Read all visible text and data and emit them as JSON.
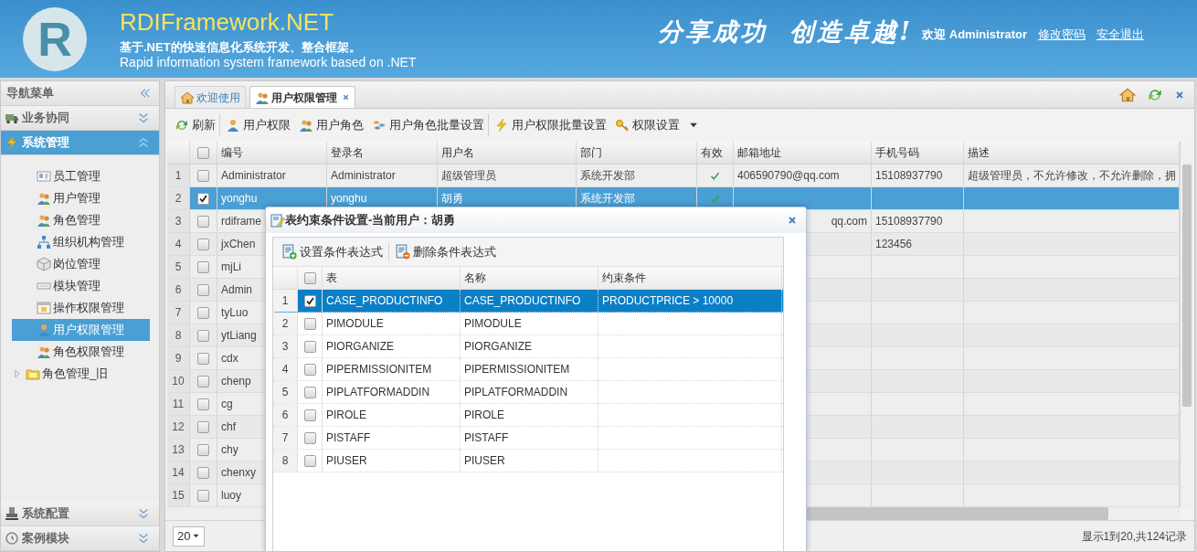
{
  "header": {
    "logo_letter": "R",
    "title": "RDIFramework.NET",
    "subtitle": "基于.NET的快速信息化系统开发、整合框架。",
    "subtitle_en": "Rapid information system framework based on .NET",
    "slogan": "分享成功  创造卓越!",
    "welcome": "欢迎 Administrator",
    "links": [
      "修改密码",
      "安全退出"
    ]
  },
  "sidebar": {
    "title": "导航菜单",
    "sections": [
      {
        "label": "业务协同",
        "expanded": false
      },
      {
        "label": "系统管理",
        "expanded": true,
        "items": [
          {
            "label": "员工管理",
            "kind": "leaf",
            "selected": false
          },
          {
            "label": "用户管理",
            "kind": "leaf",
            "selected": false
          },
          {
            "label": "角色管理",
            "kind": "leaf",
            "selected": false
          },
          {
            "label": "组织机构管理",
            "kind": "leaf",
            "selected": false
          },
          {
            "label": "岗位管理",
            "kind": "leaf",
            "selected": false
          },
          {
            "label": "模块管理",
            "kind": "leaf",
            "selected": false
          },
          {
            "label": "操作权限管理",
            "kind": "leaf",
            "selected": false
          },
          {
            "label": "用户权限管理",
            "kind": "leaf",
            "selected": true
          },
          {
            "label": "角色权限管理",
            "kind": "leaf",
            "selected": false
          },
          {
            "label": "角色管理_旧",
            "kind": "folder",
            "selected": false
          }
        ]
      },
      {
        "label": "系统配置",
        "expanded": false
      },
      {
        "label": "案例模块",
        "expanded": false
      }
    ]
  },
  "tabs": [
    {
      "label": "欢迎使用",
      "selected": false,
      "closable": false
    },
    {
      "label": "用户权限管理",
      "selected": true,
      "closable": true
    }
  ],
  "toolbar": [
    {
      "label": "刷新",
      "separator_after": true,
      "dropdown": false
    },
    {
      "label": "用户权限",
      "separator_after": false,
      "dropdown": false
    },
    {
      "label": "用户角色",
      "separator_after": false,
      "dropdown": false
    },
    {
      "label": "用户角色批量设置",
      "separator_after": true,
      "dropdown": false
    },
    {
      "label": "用户权限批量设置",
      "separator_after": false,
      "dropdown": false
    },
    {
      "label": "权限设置",
      "separator_after": false,
      "dropdown": true
    }
  ],
  "grid": {
    "header_checked": false,
    "columns": [
      "编号",
      "登录名",
      "用户名",
      "部门",
      "有效",
      "邮箱地址",
      "手机号码",
      "描述"
    ],
    "rows": [
      {
        "no": "1",
        "selected": false,
        "code": "Administrator",
        "login": "Administrator",
        "username": "超级管理员",
        "dept": "系统开发部",
        "valid": true,
        "email": "406590790@qq.com",
        "phone": "15108937790",
        "description": "超级管理员，不允许修改，不允许删除，拥"
      },
      {
        "no": "2",
        "selected": true,
        "code": "yonghu",
        "login": "yonghu",
        "username": "胡勇",
        "dept": "系统开发部",
        "valid": true
      },
      {
        "no": "3",
        "selected": false,
        "code": "rdiframe",
        "email": "qq.com",
        "phone": "15108937790"
      },
      {
        "no": "4",
        "selected": false,
        "code": "jxChen",
        "phone": "123456"
      },
      {
        "no": "5",
        "selected": false,
        "code": "mjLi"
      },
      {
        "no": "6",
        "selected": false,
        "code": "Admin"
      },
      {
        "no": "7",
        "selected": false,
        "code": "tyLuo"
      },
      {
        "no": "8",
        "selected": false,
        "code": "ytLiang"
      },
      {
        "no": "9",
        "selected": false,
        "code": "cdx"
      },
      {
        "no": "10",
        "selected": false,
        "code": "chenp"
      },
      {
        "no": "11",
        "selected": false,
        "code": "cg"
      },
      {
        "no": "12",
        "selected": false,
        "code": "chf"
      },
      {
        "no": "13",
        "selected": false,
        "code": "chy"
      },
      {
        "no": "14",
        "selected": false,
        "code": "chenxy"
      },
      {
        "no": "15",
        "selected": false,
        "code": "luoy"
      }
    ]
  },
  "pager": {
    "page_size": "20",
    "summary": "显示1到20,共124记录"
  },
  "dialog": {
    "title": "表约束条件设置-当前用户：胡勇",
    "toolbar": [
      "设置条件表达式",
      "删除条件表达式"
    ],
    "header_checked": false,
    "columns": [
      "表",
      "名称",
      "约束条件"
    ],
    "rows": [
      {
        "no": "1",
        "selected": true,
        "table": "CASE_PRODUCTINFO",
        "name": "CASE_PRODUCTINFO",
        "condition": "PRODUCTPRICE > 10000"
      },
      {
        "no": "2",
        "selected": false,
        "table": "PIMODULE",
        "name": "PIMODULE"
      },
      {
        "no": "3",
        "selected": false,
        "table": "PIORGANIZE",
        "name": "PIORGANIZE"
      },
      {
        "no": "4",
        "selected": false,
        "table": "PIPERMISSIONITEM",
        "name": "PIPERMISSIONITEM"
      },
      {
        "no": "5",
        "selected": false,
        "table": "PIPLATFORMADDIN",
        "name": "PIPLATFORMADDIN"
      },
      {
        "no": "6",
        "selected": false,
        "table": "PIROLE",
        "name": "PIROLE"
      },
      {
        "no": "7",
        "selected": false,
        "table": "PISTAFF",
        "name": "PISTAFF"
      },
      {
        "no": "8",
        "selected": false,
        "table": "PIUSER",
        "name": "PIUSER"
      }
    ]
  }
}
